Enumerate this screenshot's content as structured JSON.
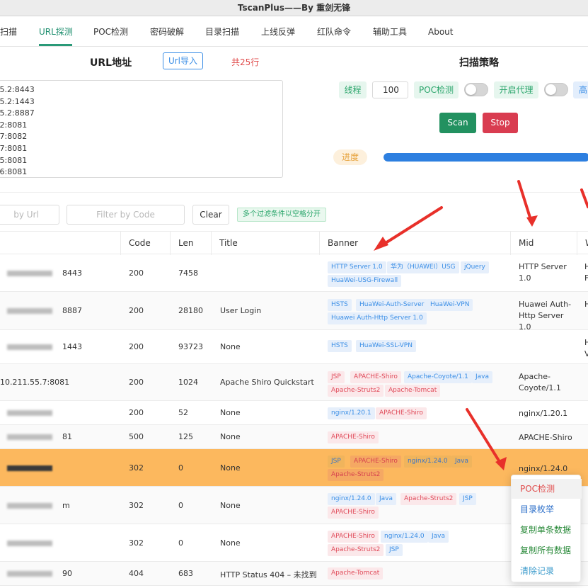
{
  "window_title": "TscanPlus——By 重剑无锋",
  "menu": [
    "扫描",
    "URL探测",
    "POC检测",
    "密码破解",
    "目录扫描",
    "上线反弹",
    "红队命令",
    "辅助工具",
    "About"
  ],
  "url_section": {
    "title": "URL地址",
    "import_button": "Url导入",
    "count": "共25行",
    "lines": [
      ".5.2:8443",
      ".5.2:1443",
      ".5.2:8887",
      ".2:8081",
      ".7:8082",
      ".7:8081",
      ".5:8081",
      ".6:8081"
    ]
  },
  "strategy": {
    "title": "扫描策略",
    "threads_label": "线程",
    "threads_value": "100",
    "poc_label": "POC检测",
    "proxy_label": "开启代理",
    "cut_label": "高",
    "scan_button": "Scan",
    "stop_button": "Stop",
    "progress_label": "进度",
    "progress_fraction": 0.97
  },
  "filters": {
    "url_placeholder": "by Url",
    "code_placeholder": "Filter by Code",
    "clear_button": "Clear",
    "hint": "多个过滤条件以空格分开"
  },
  "table": {
    "headers": [
      "Code",
      "Len",
      "Title",
      "Banner",
      "Mid",
      "W"
    ],
    "rows": [
      {
        "url": "8443",
        "code": "200",
        "len": "7458",
        "title": "",
        "banners": [
          [
            "HTTP Server 1.0",
            "b"
          ],
          [
            "华为（HUAWEI）USG",
            "b"
          ],
          [
            "jQuery",
            "b"
          ],
          [
            "HuaWei-USG-Firewall",
            "b"
          ]
        ],
        "mid": "HTTP Server 1.0",
        "w": "H\nF"
      },
      {
        "url": "8887",
        "code": "200",
        "len": "28180",
        "title": "User Login",
        "banners": [
          [
            "HSTS",
            "b"
          ],
          [
            "HuaWei-Auth-Server",
            "b"
          ],
          [
            "HuaWei-VPN",
            "b"
          ],
          [
            "Huawei Auth-Http Server 1.0",
            "b"
          ]
        ],
        "mid": "Huawei Auth-Http Server 1.0",
        "w": "H"
      },
      {
        "url": "1443",
        "code": "200",
        "len": "93723",
        "title": "None",
        "banners": [
          [
            "HSTS",
            "b"
          ],
          [
            "HuaWei-SSL-VPN",
            "b"
          ]
        ],
        "mid": "",
        "w": "H\nV"
      },
      {
        "url": "10.211.55.7:8081",
        "code": "200",
        "len": "1024",
        "title": "Apache Shiro Quickstart",
        "banners": [
          [
            "JSP",
            "r"
          ],
          [
            "APACHE-Shiro",
            "r"
          ],
          [
            "Apache-Coyote/1.1",
            "b"
          ],
          [
            "Java",
            "b"
          ],
          [
            "Apache-Struts2",
            "r"
          ],
          [
            "Apache-Tomcat",
            "r"
          ]
        ],
        "mid": "Apache-Coyote/1.1",
        "w": ""
      },
      {
        "url": "",
        "code": "200",
        "len": "52",
        "title": "None",
        "banners": [
          [
            "nginx/1.20.1",
            "b"
          ],
          [
            "APACHE-Shiro",
            "r"
          ]
        ],
        "mid": "nginx/1.20.1",
        "w": ""
      },
      {
        "url": "81",
        "code": "500",
        "len": "125",
        "title": "None",
        "banners": [
          [
            "APACHE-Shiro",
            "r"
          ]
        ],
        "mid": "APACHE-Shiro",
        "w": ""
      },
      {
        "url": "",
        "code": "302",
        "len": "0",
        "title": "None",
        "banners": [
          [
            "JSP",
            "b"
          ],
          [
            "APACHE-Shiro",
            "r"
          ],
          [
            "nginx/1.24.0",
            "b"
          ],
          [
            "Java",
            "b"
          ],
          [
            "Apache-Struts2",
            "r"
          ]
        ],
        "mid": "nginx/1.24.0",
        "w": ""
      },
      {
        "url": "m",
        "code": "302",
        "len": "0",
        "title": "None",
        "banners": [
          [
            "nginx/1.24.0",
            "b"
          ],
          [
            "Java",
            "b"
          ],
          [
            "Apache-Struts2",
            "r"
          ],
          [
            "JSP",
            "b"
          ],
          [
            "APACHE-Shiro",
            "r"
          ]
        ],
        "mid": "",
        "w": ""
      },
      {
        "url": "",
        "code": "302",
        "len": "0",
        "title": "None",
        "banners": [
          [
            "APACHE-Shiro",
            "r"
          ],
          [
            "nginx/1.24.0",
            "b"
          ],
          [
            "Java",
            "b"
          ],
          [
            "Apache-Struts2",
            "r"
          ],
          [
            "JSP",
            "b"
          ]
        ],
        "mid": "",
        "w": ""
      },
      {
        "url": "90",
        "code": "404",
        "len": "683",
        "title": "HTTP Status 404 – 未找到",
        "banners": [
          [
            "Apache-Tomcat",
            "r"
          ]
        ],
        "mid": "",
        "w": ""
      }
    ]
  },
  "context_menu": [
    {
      "label": "POC检测",
      "color": "#e04b4b"
    },
    {
      "label": "目录枚举",
      "color": "#2c6fc9"
    },
    {
      "label": "复制单条数据",
      "color": "#2a8a3a"
    },
    {
      "label": "复制所有数据",
      "color": "#2a8a3a"
    },
    {
      "label": "清除记录",
      "color": "#3a9acb"
    }
  ],
  "colors": {
    "accent": "#2a9a78",
    "scan": "#229160",
    "stop": "#d93c50",
    "progress": "#2d7fe0",
    "highlight_row": "#fcb85e",
    "arrow": "#e8302a"
  }
}
